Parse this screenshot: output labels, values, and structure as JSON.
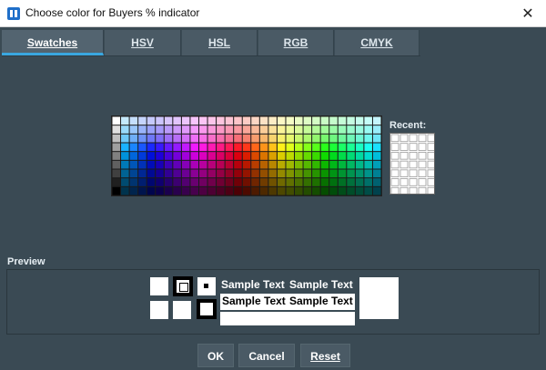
{
  "window": {
    "title": "Choose color for Buyers % indicator",
    "close_glyph": "✕",
    "app_icon": "app-icon"
  },
  "tabs": [
    {
      "label": "Swatches",
      "active": true
    },
    {
      "label": "HSV",
      "active": false
    },
    {
      "label": "HSL",
      "active": false
    },
    {
      "label": "RGB",
      "active": false
    },
    {
      "label": "CMYK",
      "active": false
    }
  ],
  "swatches": {
    "columns": 31,
    "rows": 9
  },
  "recent": {
    "label": "Recent:",
    "columns": 5,
    "rows": 7
  },
  "preview": {
    "label": "Preview",
    "sample_text": "Sample Text",
    "color": "#ffffff"
  },
  "buttons": {
    "ok": "OK",
    "cancel": "Cancel",
    "reset": "Reset"
  },
  "colors": {
    "background": "#3a4a54",
    "tab_active_underline": "#3aa7e0"
  }
}
